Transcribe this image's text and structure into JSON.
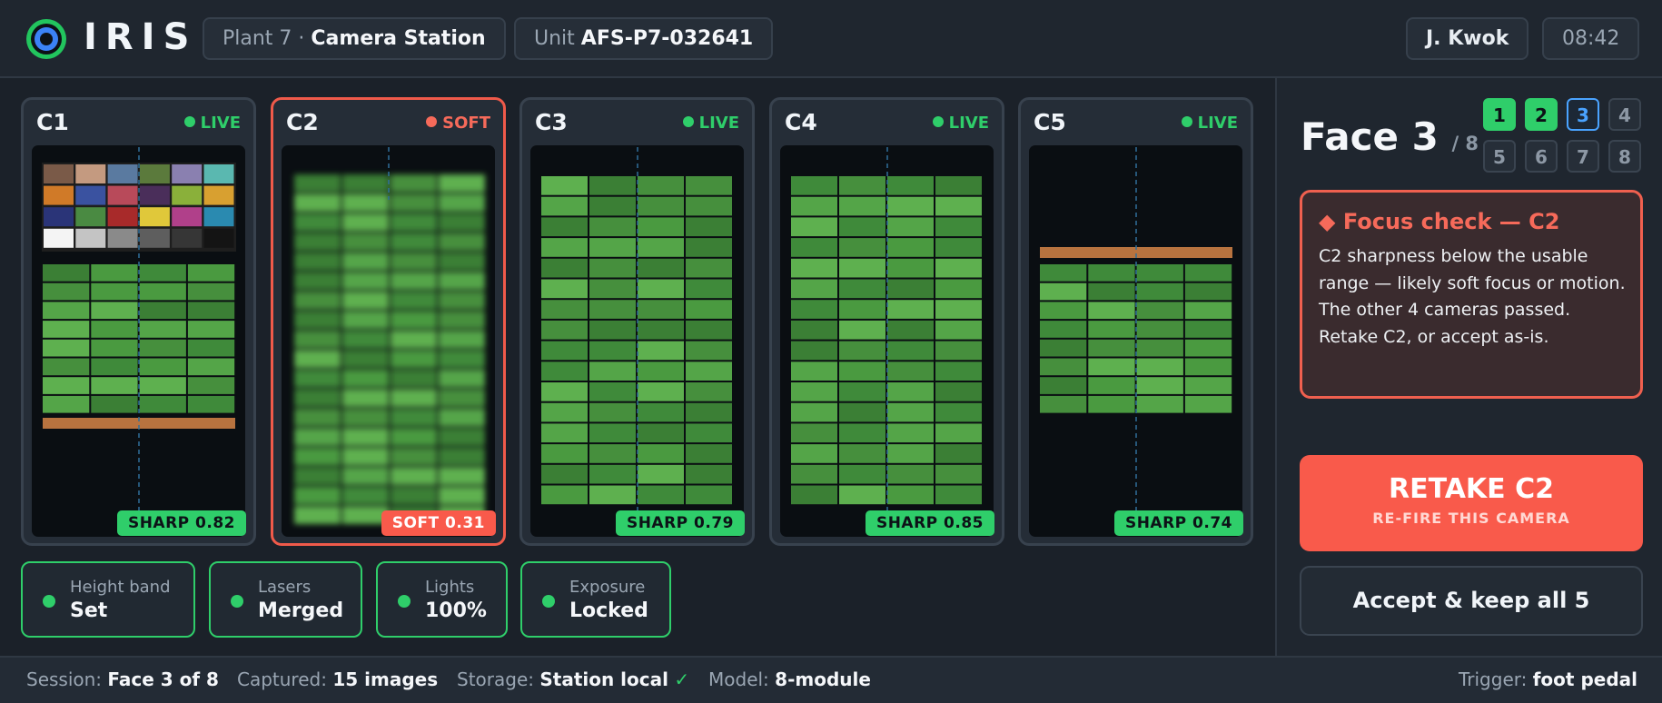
{
  "header": {
    "brand": "IRIS",
    "location_prefix": "Plant 7 ·",
    "location": "Camera Station",
    "unit_prefix": "Unit",
    "unit": "AFS-P7-032641",
    "user": "J. Kwok",
    "time": "08:42"
  },
  "colors": {
    "ok": "#2fce6a",
    "alert": "#f95a4b",
    "current": "#4aa3ff"
  },
  "cameras": [
    {
      "label": "C1",
      "status": "LIVE",
      "state": "ok",
      "badge": "SHARP 0.82",
      "sharpness": 0.82
    },
    {
      "label": "C2",
      "status": "SOFT",
      "state": "alert",
      "badge": "SOFT 0.31",
      "sharpness": 0.31
    },
    {
      "label": "C3",
      "status": "LIVE",
      "state": "ok",
      "badge": "SHARP 0.79",
      "sharpness": 0.79
    },
    {
      "label": "C4",
      "status": "LIVE",
      "state": "ok",
      "badge": "SHARP 0.85",
      "sharpness": 0.85
    },
    {
      "label": "C5",
      "status": "LIVE",
      "state": "ok",
      "badge": "SHARP 0.74",
      "sharpness": 0.74
    }
  ],
  "chips": [
    {
      "key": "Height band",
      "value": "Set"
    },
    {
      "key": "Lasers",
      "value": "Merged"
    },
    {
      "key": "Lights",
      "value": "100%"
    },
    {
      "key": "Exposure",
      "value": "Locked"
    }
  ],
  "face": {
    "title": "Face 3",
    "total": "/ 8",
    "buttons": [
      {
        "label": "1",
        "state": "done"
      },
      {
        "label": "2",
        "state": "done"
      },
      {
        "label": "3",
        "state": "current"
      },
      {
        "label": "4",
        "state": "pending"
      },
      {
        "label": "5",
        "state": "pending"
      },
      {
        "label": "6",
        "state": "pending"
      },
      {
        "label": "7",
        "state": "pending"
      },
      {
        "label": "8",
        "state": "pending"
      }
    ]
  },
  "alert": {
    "heading": "◆ Focus check — C2",
    "body": "C2 sharpness below the usable range — likely soft focus or motion. The other 4 cameras passed. Retake C2, or accept as-is."
  },
  "actions": {
    "retake_label": "RETAKE C2",
    "retake_sub": "RE-FIRE THIS CAMERA",
    "accept_label": "Accept & keep all 5"
  },
  "footer": {
    "session_key": "Session:",
    "session": "Face 3 of 8",
    "captured_key": "Captured:",
    "captured": "15 images",
    "storage_key": "Storage:",
    "storage": "Station local",
    "storage_ok": "✓",
    "model_key": "Model:",
    "model": "8-module",
    "trigger_key": "Trigger:",
    "trigger": "foot pedal"
  }
}
